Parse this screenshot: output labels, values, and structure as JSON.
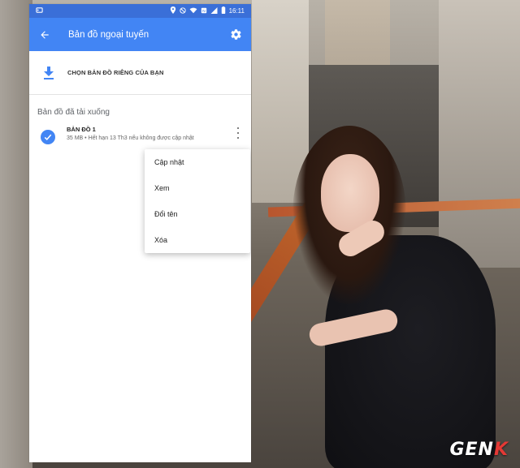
{
  "statusbar": {
    "time": "16:11",
    "left_icon": "notification-icon",
    "right_icons": [
      "location-icon",
      "mute-icon",
      "wifi-icon",
      "nfc-icon",
      "signal-icon",
      "battery-icon"
    ]
  },
  "appbar": {
    "title": "Bản đồ ngoại tuyến",
    "color": "#4285f4"
  },
  "choose_custom_map": {
    "label": "CHỌN BẢN ĐỒ RIÊNG CỦA BẠN"
  },
  "downloaded_section": {
    "title": "Bản đồ đã tải xuống",
    "items": [
      {
        "name": "BẢN ĐỒ 1",
        "meta": "35 MB • Hết hạn 13 Th3 nếu không được cập nhật"
      }
    ]
  },
  "context_menu": {
    "items": [
      {
        "label": "Cập nhật"
      },
      {
        "label": "Xem"
      },
      {
        "label": "Đổi tên"
      },
      {
        "label": "Xóa"
      }
    ]
  },
  "watermark": {
    "text_main": "GEN",
    "text_accent": "K"
  }
}
